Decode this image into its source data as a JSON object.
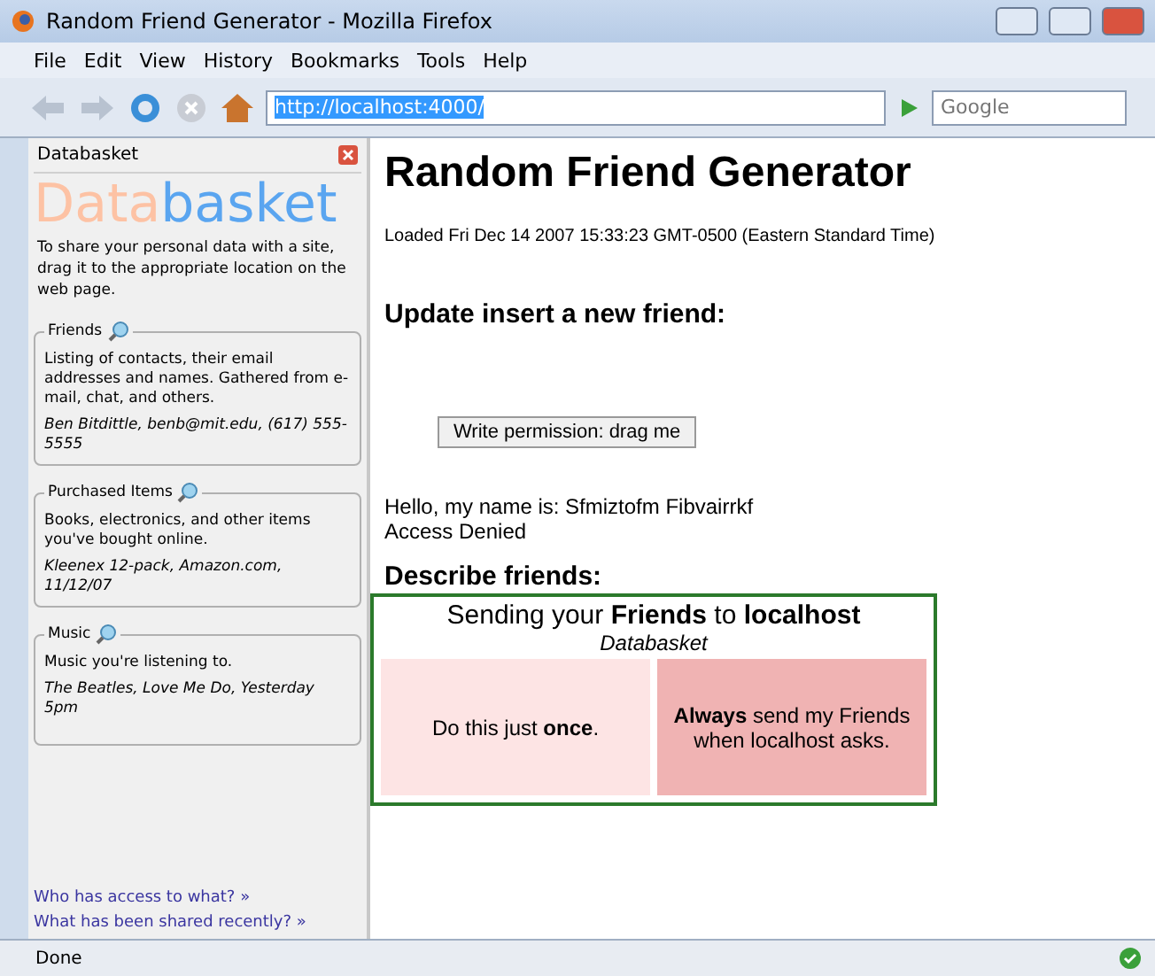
{
  "window": {
    "title": "Random Friend Generator - Mozilla Firefox"
  },
  "menu": [
    "File",
    "Edit",
    "View",
    "History",
    "Bookmarks",
    "Tools",
    "Help"
  ],
  "address": {
    "value": "http://localhost:4000/",
    "selected": true
  },
  "search": {
    "placeholder": "Google"
  },
  "sidebar": {
    "title": "Databasket",
    "logo": [
      "Data",
      "basket"
    ],
    "intro": "To share your personal data with a site, drag it to the appropriate location on the web page.",
    "groups": [
      {
        "title": "Friends",
        "description": "Listing of contacts, their email addresses and names. Gathered from e-mail, chat, and others.",
        "example": "Ben Bitdittle, benb@mit.edu, (617) 555-5555"
      },
      {
        "title": "Purchased Items",
        "description": "Books, electronics, and other items you've bought online.",
        "example": "Kleenex 12-pack, Amazon.com, 11/12/07"
      },
      {
        "title": "Music",
        "description": "Music you're listening to.",
        "example": "The Beatles, Love Me Do, Yesterday 5pm"
      }
    ],
    "links": [
      "Who has access to what? »",
      "What has been shared recently? »"
    ]
  },
  "page": {
    "heading": "Random Friend Generator",
    "loaded": "Loaded Fri Dec 14 2007 15:33:23 GMT-0500 (Eastern Standard Time)",
    "update_heading": "Update insert a new friend:",
    "drag_button": "Write permission: drag me",
    "hello": "Hello, my name is: Sfmiztofm Fibvairrkf",
    "access": "Access Denied",
    "describe_heading": "Describe friends:"
  },
  "popup": {
    "title": "Sending your **Friends** to **localhost**",
    "subtitle": "Databasket",
    "options": [
      "Do this just **once**.",
      "**Always** send my Friends when localhost asks."
    ]
  },
  "status_bar": {
    "text": "Done"
  }
}
